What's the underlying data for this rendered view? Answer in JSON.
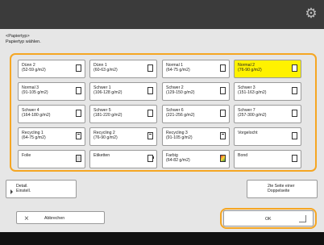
{
  "header": {
    "settings_icon": "gear-icon"
  },
  "breadcrumb": {
    "line1": "<Papiertyp>",
    "line2": "Papiertyp wählen."
  },
  "paper_types": [
    {
      "label": "Dünn 2\n(52-59 g/m2)",
      "icon": "plain-paper-icon",
      "selected": false
    },
    {
      "label": "Dünn 1\n(60-63 g/m2)",
      "icon": "plain-paper-icon",
      "selected": false
    },
    {
      "label": "Normal 1\n(64-75 g/m2)",
      "icon": "plain-paper-icon",
      "selected": false
    },
    {
      "label": "Normal 2\n(76-90 g/m2)",
      "icon": "plain-paper-icon",
      "selected": true
    },
    {
      "label": "Normal 3\n(91-105 g/m2)",
      "icon": "plain-paper-icon",
      "selected": false
    },
    {
      "label": "Schwer 1\n(106-128 g/m2)",
      "icon": "plain-paper-icon",
      "selected": false
    },
    {
      "label": "Schwer 2\n(129-150 g/m2)",
      "icon": "plain-paper-icon",
      "selected": false
    },
    {
      "label": "Schwer 3\n(151-163 g/m2)",
      "icon": "plain-paper-icon",
      "selected": false
    },
    {
      "label": "Schwer 4\n(164-180 g/m2)",
      "icon": "plain-paper-icon",
      "selected": false
    },
    {
      "label": "Schwer 5\n(181-220 g/m2)",
      "icon": "plain-paper-icon",
      "selected": false
    },
    {
      "label": "Schwer 6\n(221-256 g/m2)",
      "icon": "plain-paper-icon",
      "selected": false
    },
    {
      "label": "Schwer 7\n(257-300 g/m2)",
      "icon": "plain-paper-icon",
      "selected": false
    },
    {
      "label": "Recycling 1\n(64-75 g/m2)",
      "icon": "recycled-paper-icon",
      "selected": false
    },
    {
      "label": "Recycling 2\n(76-90 g/m2)",
      "icon": "recycled-paper-icon",
      "selected": false
    },
    {
      "label": "Recycling 3\n(91-105 g/m2)",
      "icon": "recycled-paper-icon",
      "selected": false
    },
    {
      "label": "Vorgelocht",
      "icon": "plain-paper-icon",
      "selected": false
    },
    {
      "label": "Folie",
      "icon": "transparency-icon",
      "selected": false
    },
    {
      "label": "Etiketten",
      "icon": "label-sheet-icon",
      "selected": false
    },
    {
      "label": "Farbig\n(64-82 g/m2)",
      "icon": "color-paper-icon",
      "selected": false
    },
    {
      "label": "Bond",
      "icon": "plain-paper-icon",
      "selected": false
    }
  ],
  "detail_button": {
    "label": "Detail.\nEinstell."
  },
  "two_sided_button": {
    "label": "2te Seite einer\nDoppelseite"
  },
  "cancel_button": {
    "label": "Abbrechen"
  },
  "ok_button": {
    "label": "OK"
  },
  "colors": {
    "accent": "#f5a623",
    "selected": "#fff200",
    "panel": "#e6e6e6"
  }
}
